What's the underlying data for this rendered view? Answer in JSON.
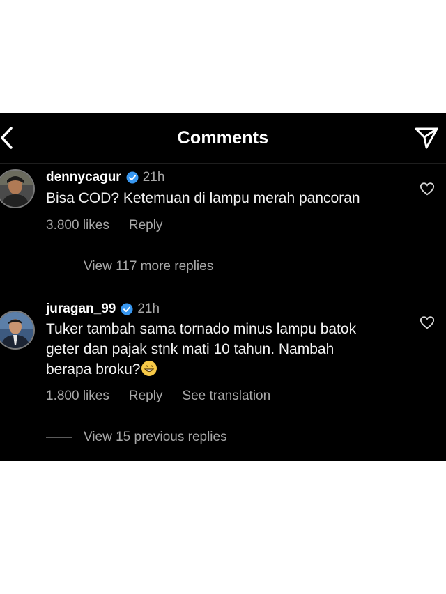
{
  "header": {
    "title": "Comments",
    "back_icon": "chevron-left-icon",
    "share_icon": "paper-plane-icon"
  },
  "comments": [
    {
      "username": "dennycagur",
      "verified": true,
      "time": "21h",
      "text": "Bisa COD? Ketemuan di lampu merah pancoran",
      "likes": "3.800 likes",
      "reply_label": "Reply",
      "view_replies": "View 117 more replies"
    },
    {
      "username": "juragan_99",
      "verified": true,
      "time": "21h",
      "text": "Tuker tambah sama tornado minus lampu batok geter dan pajak stnk mati 10 tahun. Nambah berapa broku?",
      "emoji": "grinning-face-emoji",
      "likes": "1.800 likes",
      "reply_label": "Reply",
      "translation_label": "See translation",
      "view_replies": "View 15 previous replies"
    }
  ],
  "colors": {
    "background": "#000000",
    "page_background": "#ffffff",
    "text_primary": "#ffffff",
    "text_secondary": "#a8a8a8",
    "verified_badge": "#3897f0"
  }
}
